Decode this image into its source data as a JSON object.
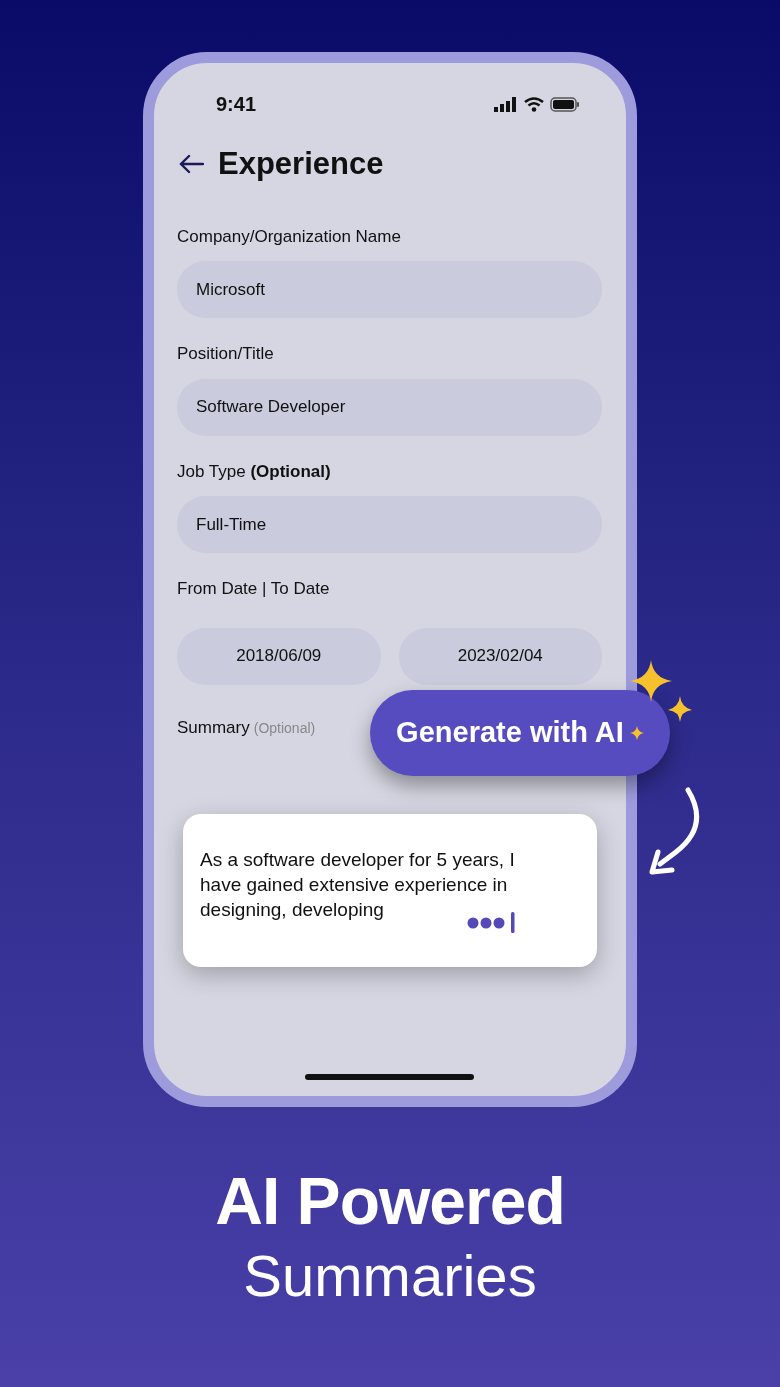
{
  "status_bar": {
    "time": "9:41"
  },
  "header": {
    "title": "Experience"
  },
  "fields": [
    {
      "label": "Company/Organization Name",
      "value": "Microsoft"
    },
    {
      "label": "Position/Title",
      "value": "Software Developer"
    },
    {
      "label": "Job Type **(Optional)**",
      "value": "Full-Time"
    }
  ],
  "date_range": {
    "label": "From Date | To Date",
    "from": "2018/06/09",
    "to": "2023/02/04"
  },
  "summary": {
    "label": "Summary",
    "hint": "(Optional)",
    "text": "As  a software developer for 5 years, I have gained extensive experience in designing, developing"
  },
  "ai_button": {
    "label": "Generate with AI"
  },
  "headline": {
    "title": "AI Powered",
    "subtitle": "Summaries"
  }
}
